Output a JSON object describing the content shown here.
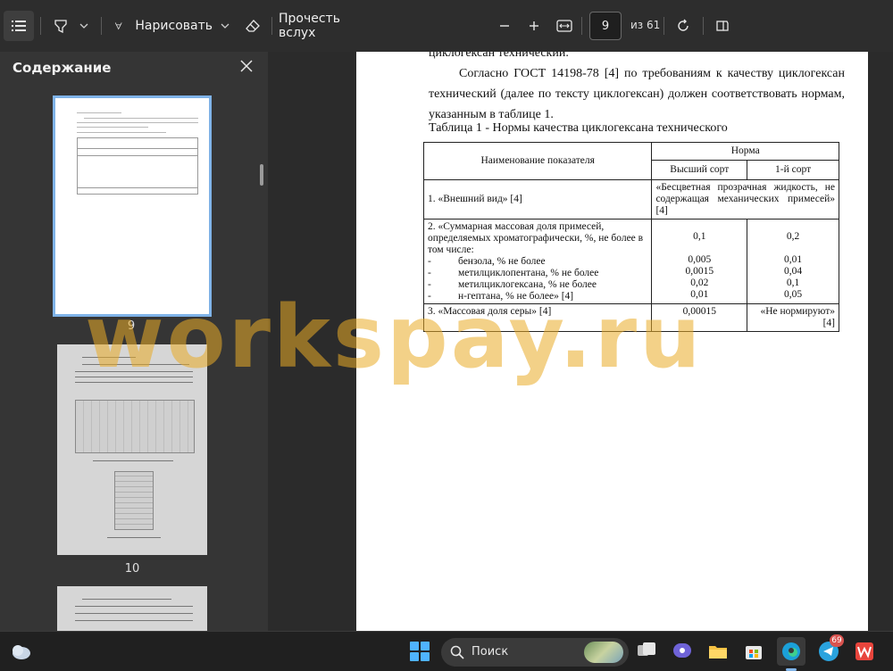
{
  "toolbar": {
    "draw_label": "Нарисовать",
    "read_aloud_label": "Прочесть вслух",
    "page_number": "9",
    "page_total": "из 61"
  },
  "sidebar": {
    "title": "Содержание",
    "thumbnails": [
      {
        "page": "9"
      },
      {
        "page": "10"
      }
    ]
  },
  "document": {
    "line1": "циклогексан технический.",
    "para": "Согласно ГОСТ 14198-78 [4] по требованиям к качеству циклогексан технический (далее по тексту циклогексан) должен соответствовать нормам, указанным в таблице 1.",
    "table_caption": "Таблица 1 - Нормы качества циклогексана технического",
    "table": {
      "h_name": "Наименование показателя",
      "h_norm": "Норма",
      "h_top": "Высший сорт",
      "h_first": "1-й сорт",
      "r1_name": "1. «Внешний вид» [4]",
      "r1_value": "«Бесцветная прозрачная жидкость, не содержащая механических примесей» [4]",
      "r2_name": "2. «Суммарная массовая доля примесей, определяемых хроматографически, %, не более в том числе:",
      "r2_top": "0,1",
      "r2_first": "0,2",
      "r2a_name": "бензола, % не более",
      "r2a_top": "0,005",
      "r2a_first": "0,01",
      "r2b_name": "метилциклопентана, % не более",
      "r2b_top": "0,0015",
      "r2b_first": "0,04",
      "r2c_name": "метилциклогексана, % не более",
      "r2c_top": "0,02",
      "r2c_first": "0,1",
      "r2d_name": "н-гептана, % не более» [4]",
      "r2d_top": "0,01",
      "r2d_first": "0,05",
      "dash": "-",
      "r3_name": "3. «Массовая доля серы» [4]",
      "r3_top": "0,00015",
      "r3_first": "«Не нормируют» [4]"
    }
  },
  "watermark": "workspay.ru",
  "taskbar": {
    "search_label": "Поиск",
    "telegram_badge": "69"
  },
  "colors": {
    "toolbar_bg": "#2d2d2d",
    "sidebar_bg": "#353535",
    "selected_outline": "#7fb3e8",
    "watermark": "#e9ac26"
  }
}
